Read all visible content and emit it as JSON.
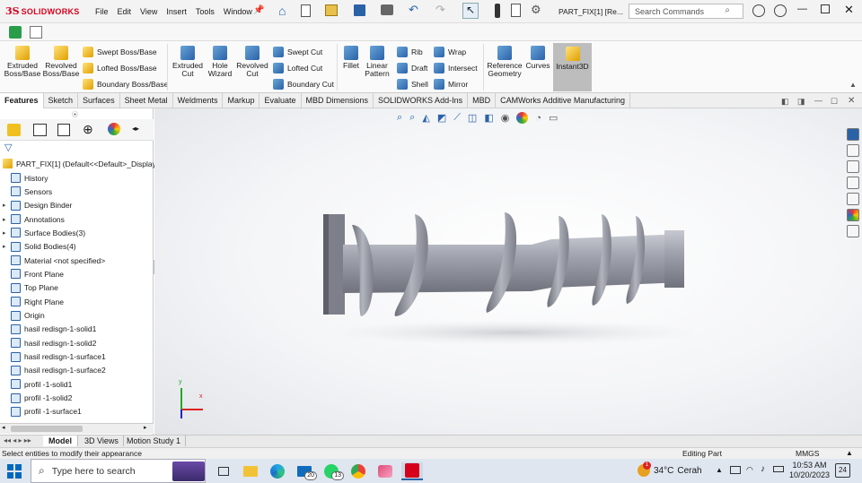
{
  "app": {
    "brand_ds": "3S",
    "brand_name": "SOLIDWORKS",
    "doc_title": "PART_FIX[1] [Re..."
  },
  "menu": [
    "File",
    "Edit",
    "View",
    "Insert",
    "Tools",
    "Window"
  ],
  "search": {
    "placeholder": "Search Commands"
  },
  "ribbon": {
    "extruded_boss": "Extruded Boss/Base",
    "revolved_boss": "Revolved Boss/Base",
    "swept_boss": "Swept Boss/Base",
    "lofted_boss": "Lofted Boss/Base",
    "boundary_boss": "Boundary Boss/Base",
    "extruded_cut": "Extruded Cut",
    "hole_wizard": "Hole Wizard",
    "revolved_cut": "Revolved Cut",
    "swept_cut": "Swept Cut",
    "lofted_cut": "Lofted Cut",
    "boundary_cut": "Boundary Cut",
    "fillet": "Fillet",
    "linear_pattern": "Linear Pattern",
    "rib": "Rib",
    "draft": "Draft",
    "shell": "Shell",
    "wrap": "Wrap",
    "intersect": "Intersect",
    "mirror": "Mirror",
    "reference_geometry": "Reference Geometry",
    "curves": "Curves",
    "instant3d": "Instant3D"
  },
  "tabs": [
    "Features",
    "Sketch",
    "Surfaces",
    "Sheet Metal",
    "Weldments",
    "Markup",
    "Evaluate",
    "MBD Dimensions",
    "SOLIDWORKS Add-Ins",
    "MBD",
    "CAMWorks Additive Manufacturing"
  ],
  "tree": {
    "root": "PART_FIX[1]  (Default<<Default>_Display",
    "items": [
      {
        "label": "History",
        "exp": false
      },
      {
        "label": "Sensors",
        "exp": false
      },
      {
        "label": "Design Binder",
        "exp": true
      },
      {
        "label": "Annotations",
        "exp": true
      },
      {
        "label": "Surface Bodies(3)",
        "exp": true
      },
      {
        "label": "Solid Bodies(4)",
        "exp": true
      },
      {
        "label": "Material <not specified>",
        "exp": false
      },
      {
        "label": "Front Plane",
        "exp": false
      },
      {
        "label": "Top Plane",
        "exp": false
      },
      {
        "label": "Right Plane",
        "exp": false
      },
      {
        "label": "Origin",
        "exp": false
      },
      {
        "label": "hasil redisgn-1-solid1",
        "exp": false
      },
      {
        "label": "hasil redisgn-1-solid2",
        "exp": false
      },
      {
        "label": "hasil redisgn-1-surface1",
        "exp": false
      },
      {
        "label": "hasil redisgn-1-surface2",
        "exp": false
      },
      {
        "label": "profil -1-solid1",
        "exp": false
      },
      {
        "label": "profil -1-solid2",
        "exp": false
      },
      {
        "label": "profil -1-surface1",
        "exp": false
      }
    ]
  },
  "bottom_tabs": [
    "Model",
    "3D Views",
    "Motion Study 1"
  ],
  "status": {
    "message": "Select entities to modify their appearance",
    "mode": "Editing Part",
    "units": "MMGS"
  },
  "taskbar": {
    "search_placeholder": "Type here to search",
    "badge_mail": "20",
    "badge_whatsapp": "13",
    "weather_alert": "1",
    "temperature": "34°C",
    "weather": "Cerah",
    "time": "10:53 AM",
    "date": "10/20/2023",
    "notifications": "24"
  },
  "axes": {
    "x": "x",
    "y": "y"
  },
  "colors": {
    "brand": "#d6001c",
    "part": "#9a9ca6",
    "accent": "#2a62a8"
  }
}
